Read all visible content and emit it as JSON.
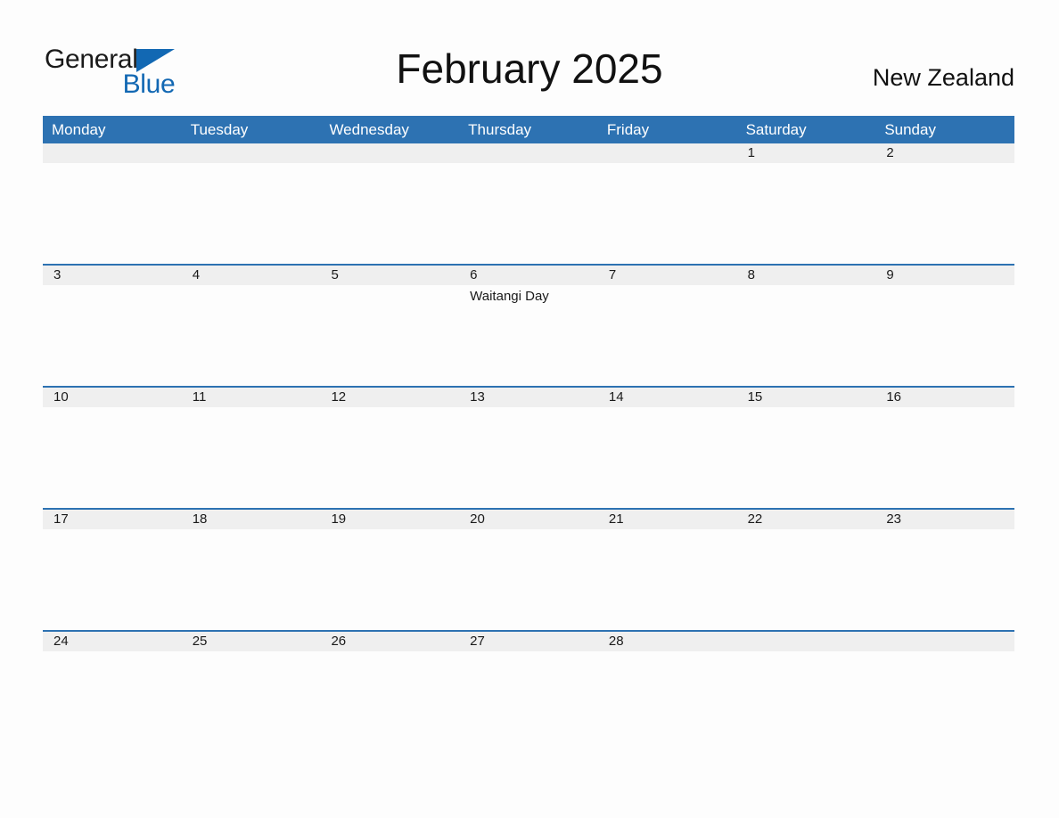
{
  "brand": {
    "name_part1": "General",
    "name_part2": "Blue",
    "triangle_color": "#1268b3"
  },
  "header": {
    "title": "February 2025",
    "region": "New Zealand"
  },
  "theme": {
    "accent": "#2d72b2",
    "date_band": "#efefef",
    "page_background": "#fdfdfd",
    "text": "#1a1a1a"
  },
  "calendar": {
    "weekdays": [
      "Monday",
      "Tuesday",
      "Wednesday",
      "Thursday",
      "Friday",
      "Saturday",
      "Sunday"
    ],
    "weeks": [
      {
        "days": [
          {
            "date": "",
            "event": ""
          },
          {
            "date": "",
            "event": ""
          },
          {
            "date": "",
            "event": ""
          },
          {
            "date": "",
            "event": ""
          },
          {
            "date": "",
            "event": ""
          },
          {
            "date": "1",
            "event": ""
          },
          {
            "date": "2",
            "event": ""
          }
        ]
      },
      {
        "days": [
          {
            "date": "3",
            "event": ""
          },
          {
            "date": "4",
            "event": ""
          },
          {
            "date": "5",
            "event": ""
          },
          {
            "date": "6",
            "event": "Waitangi Day"
          },
          {
            "date": "7",
            "event": ""
          },
          {
            "date": "8",
            "event": ""
          },
          {
            "date": "9",
            "event": ""
          }
        ]
      },
      {
        "days": [
          {
            "date": "10",
            "event": ""
          },
          {
            "date": "11",
            "event": ""
          },
          {
            "date": "12",
            "event": ""
          },
          {
            "date": "13",
            "event": ""
          },
          {
            "date": "14",
            "event": ""
          },
          {
            "date": "15",
            "event": ""
          },
          {
            "date": "16",
            "event": ""
          }
        ]
      },
      {
        "days": [
          {
            "date": "17",
            "event": ""
          },
          {
            "date": "18",
            "event": ""
          },
          {
            "date": "19",
            "event": ""
          },
          {
            "date": "20",
            "event": ""
          },
          {
            "date": "21",
            "event": ""
          },
          {
            "date": "22",
            "event": ""
          },
          {
            "date": "23",
            "event": ""
          }
        ]
      },
      {
        "days": [
          {
            "date": "24",
            "event": ""
          },
          {
            "date": "25",
            "event": ""
          },
          {
            "date": "26",
            "event": ""
          },
          {
            "date": "27",
            "event": ""
          },
          {
            "date": "28",
            "event": ""
          },
          {
            "date": "",
            "event": ""
          },
          {
            "date": "",
            "event": ""
          }
        ]
      }
    ]
  }
}
